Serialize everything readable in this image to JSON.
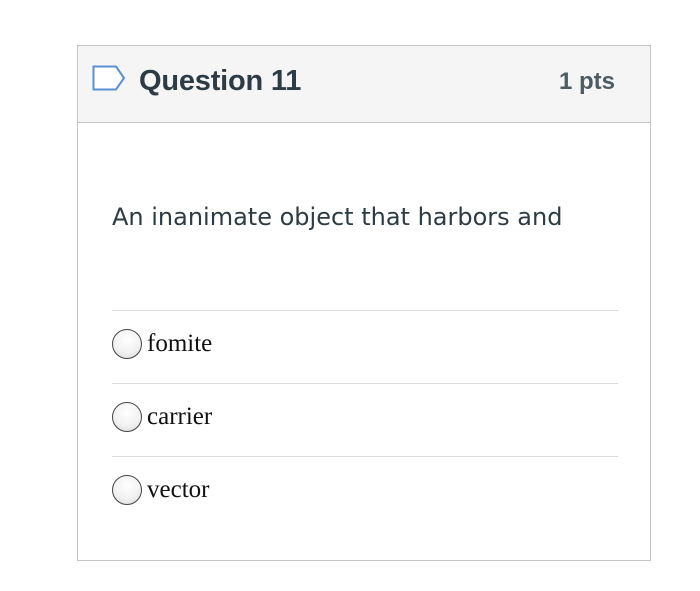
{
  "question": {
    "title": "Question 11",
    "points": "1 pts",
    "text": "An inanimate object that harbors and",
    "flag_icon": "bookmark-flag-icon"
  },
  "answers": [
    {
      "label": "fomite",
      "selected": false
    },
    {
      "label": "carrier",
      "selected": false
    },
    {
      "label": "vector",
      "selected": false
    }
  ],
  "colors": {
    "header_background": "#f5f5f5",
    "border": "#c4c4c4",
    "flag_stroke": "#5a8fd0",
    "title_text": "#2d3b45"
  }
}
